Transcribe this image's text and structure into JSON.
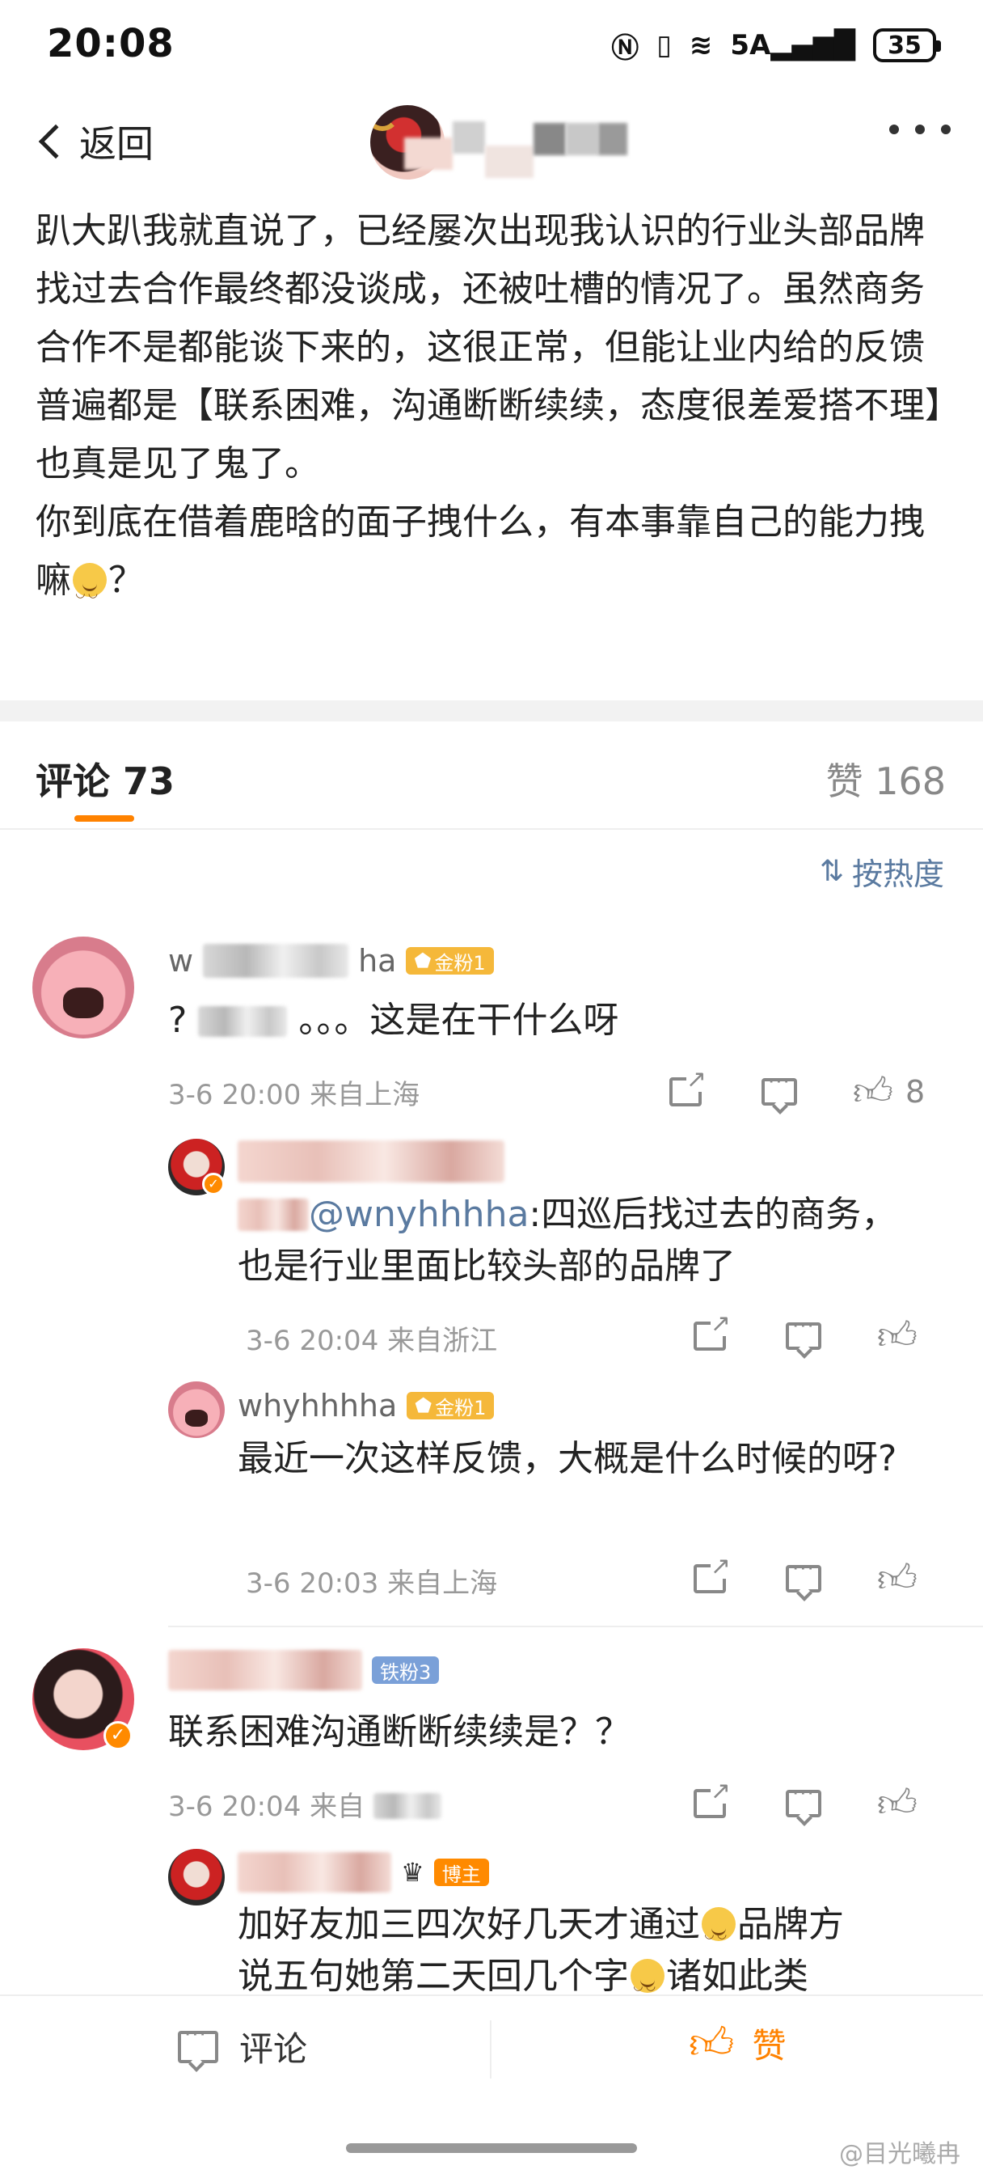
{
  "status_bar": {
    "time": "20:08",
    "icons": [
      "nfc-icon",
      "vibrate-icon",
      "wifi-icon",
      "signal-5a-icon"
    ],
    "network_label": "5A",
    "battery": "35"
  },
  "nav": {
    "back_label": "返回"
  },
  "post": {
    "text": "趴大趴我就直说了，已经屡次出现我认识的行业头部品牌找过去合作最终都没谈成，还被吐槽的情况了。虽然商务合作不是都能谈下来的，这很正常，但能让业内给的反馈普遍都是【联系困难，沟通断断续续，态度很差爱搭不理】也真是见了鬼了。\n你到底在借着鹿晗的面子拽什么，有本事靠自己的能力拽嘛",
    "text_end": "？"
  },
  "tabs": {
    "comments_label": "评论",
    "comments_count": "73",
    "likes_label": "赞",
    "likes_count": "168"
  },
  "sort": {
    "label": "按热度"
  },
  "comments": [
    {
      "name_visible": "w",
      "name_tail": "ha",
      "badge": "金粉1",
      "text_start": "?",
      "text": "。。。这是在干什么呀",
      "meta": "3-6 20:00 来自上海",
      "like_count": "8"
    },
    {
      "reply_prefix": "回复",
      "mention": "@wnyhhhha",
      "text": ":四巡后找过去的商务，也是行业里面比较头部的品牌了",
      "meta": "3-6 20:04 来自浙江"
    },
    {
      "name": "whyhhhha",
      "badge": "金粉1",
      "text": "最近一次这样反馈，大概是什么时候的呀?",
      "meta": "3-6 20:03 来自上海"
    },
    {
      "badge": "铁粉3",
      "text": "联系困难沟通断断续续是？？",
      "meta": "3-6 20:04 来自"
    },
    {
      "badge": "博主",
      "text_line1": "加好友加三四次好几天才通过",
      "text_line1_end": "品牌方",
      "text_line2": "说五句她第二天回几个字",
      "text_line2_end": "诸如此类"
    }
  ],
  "bottom_bar": {
    "comment_label": "评论",
    "like_label": "赞"
  },
  "watermark": "@目光曦冉",
  "colors": {
    "accent": "#ff8200",
    "link": "#5a7aa0",
    "muted": "#999999"
  }
}
